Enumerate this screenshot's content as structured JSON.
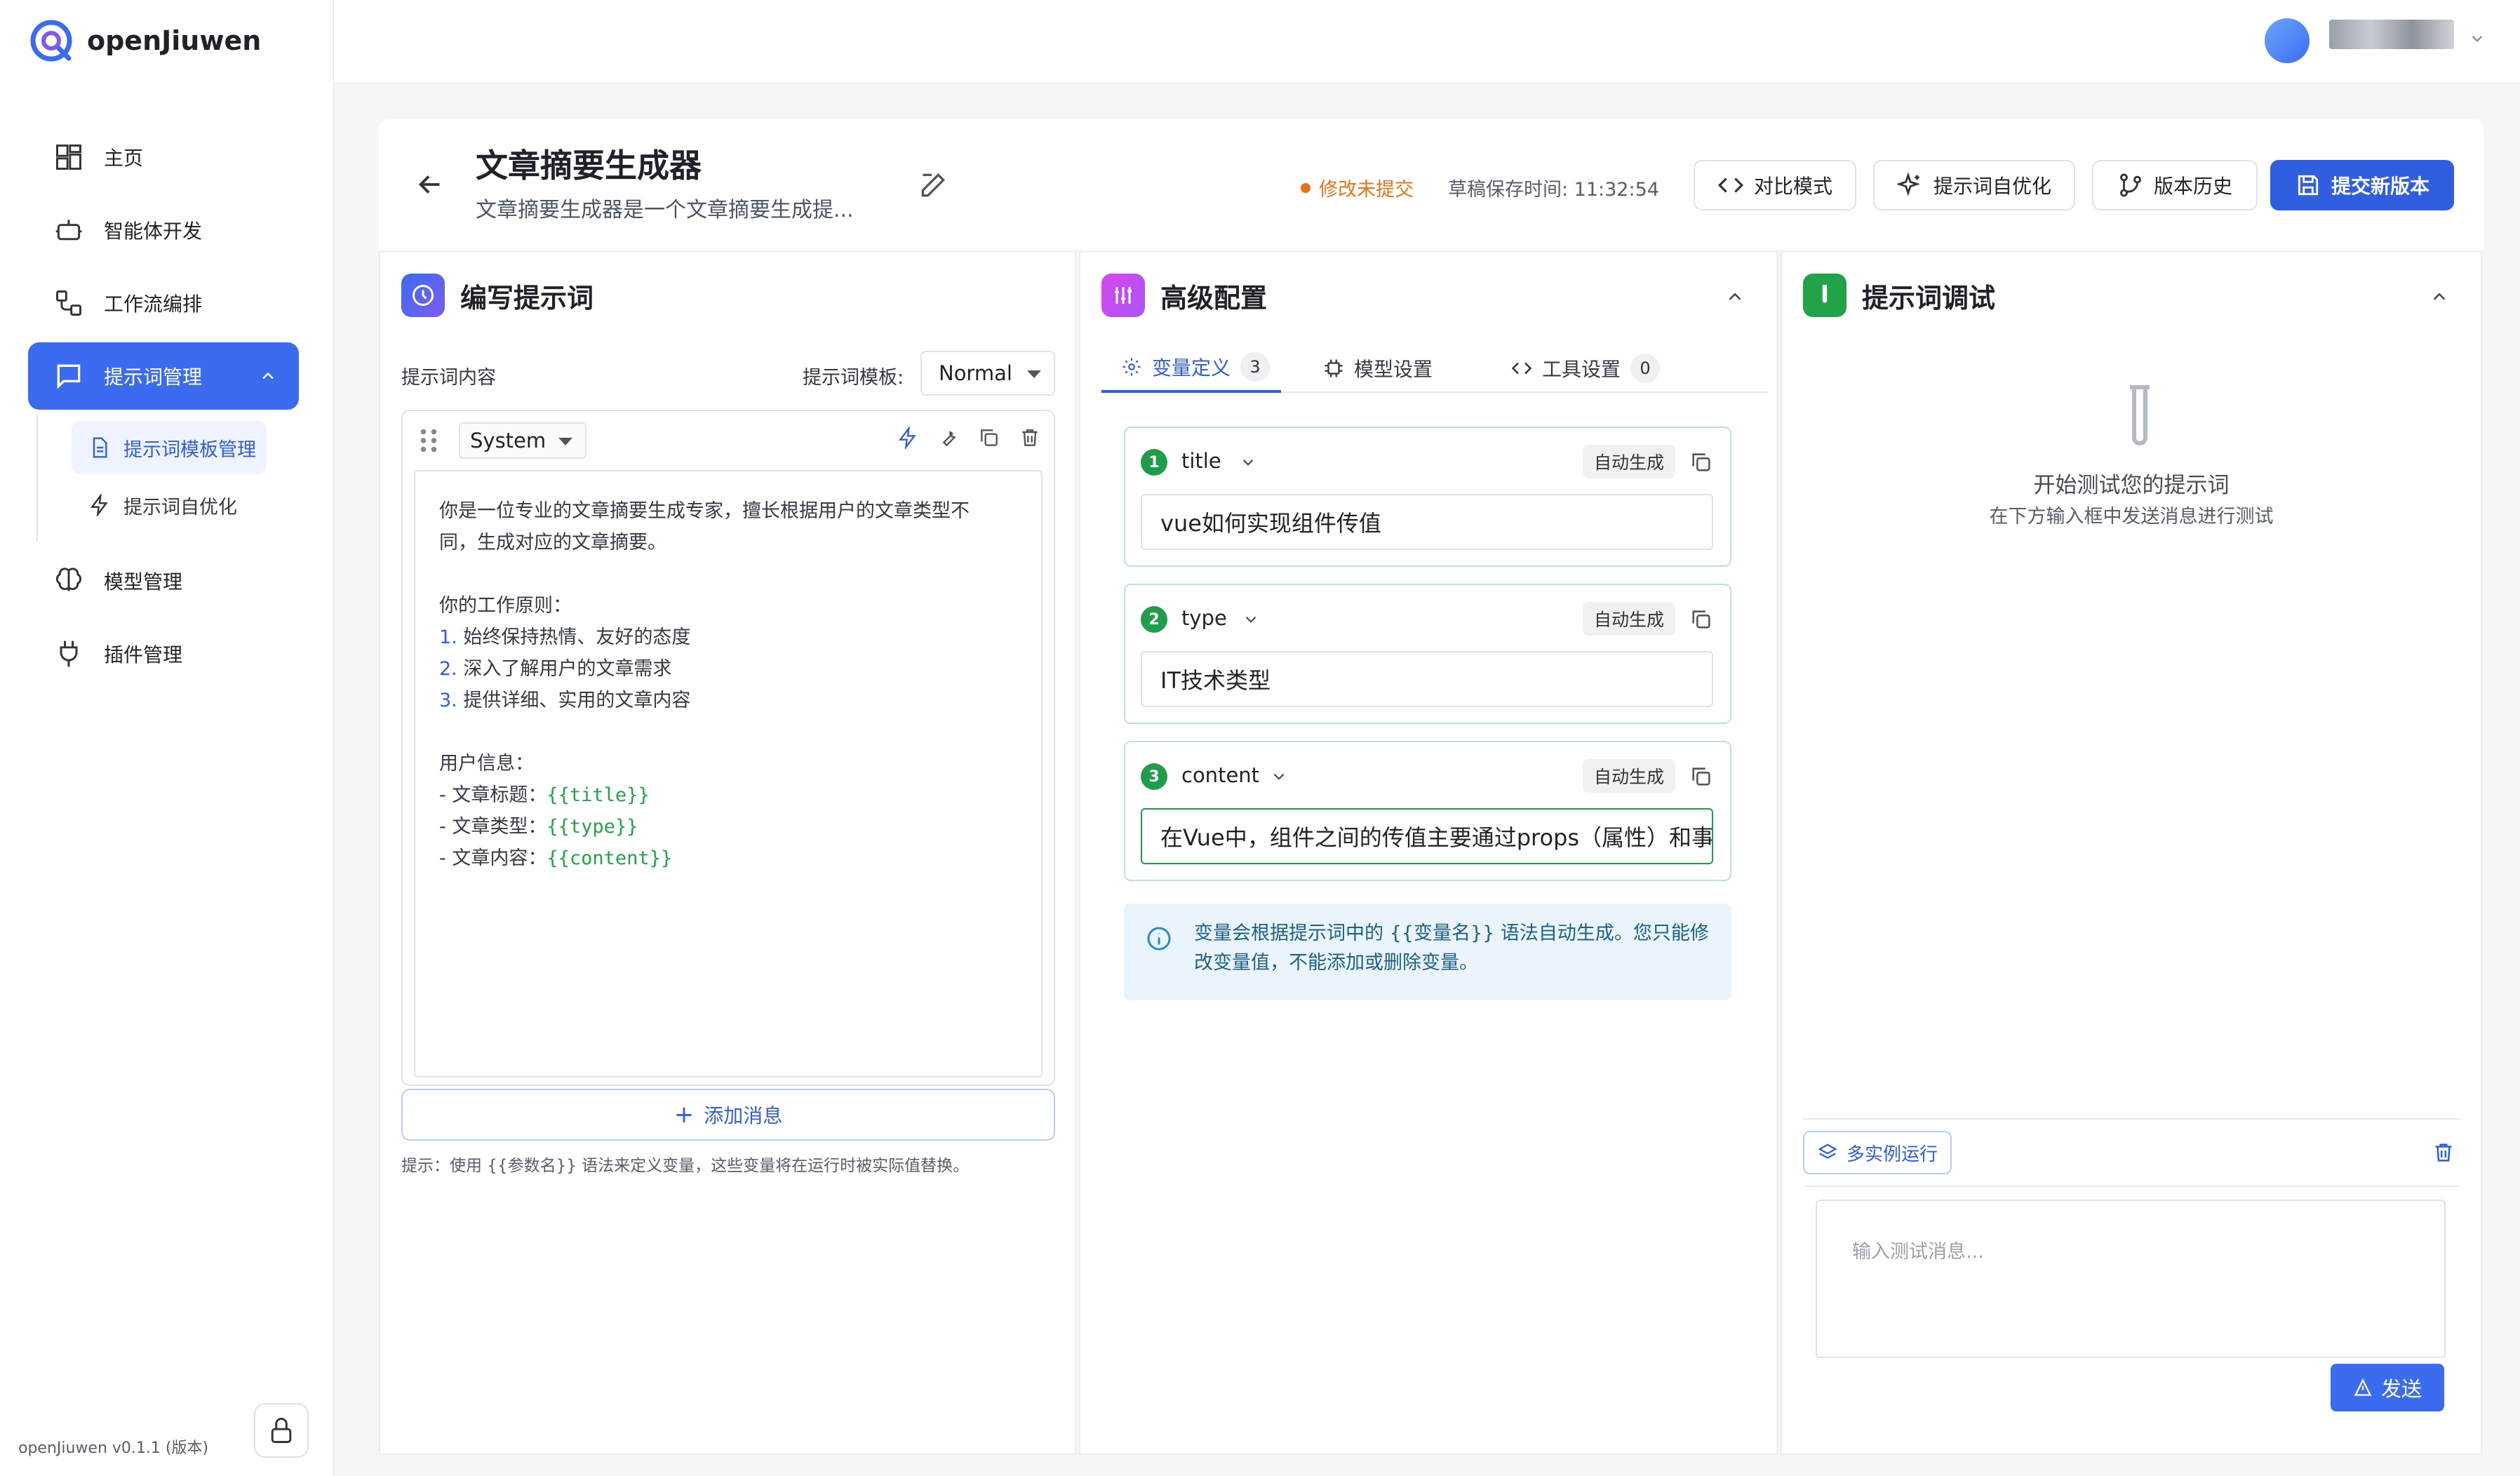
{
  "brand": {
    "name": "openJiuwen"
  },
  "sidebar": {
    "items": [
      {
        "label": "主页",
        "icon": "dashboard-icon"
      },
      {
        "label": "智能体开发",
        "icon": "robot-icon"
      },
      {
        "label": "工作流编排",
        "icon": "workflow-icon"
      },
      {
        "label": "提示词管理",
        "icon": "message-icon",
        "active": true
      },
      {
        "label": "模型管理",
        "icon": "brain-icon"
      },
      {
        "label": "插件管理",
        "icon": "plug-icon"
      }
    ],
    "subitems": [
      {
        "label": "提示词模板管理",
        "icon": "document-icon",
        "active": true
      },
      {
        "label": "提示词自优化",
        "icon": "lightning-icon"
      }
    ],
    "version": "openJiuwen v0.1.1 (版本)"
  },
  "header": {
    "title": "文章摘要生成器",
    "description": "文章摘要生成器是一个文章摘要生成提...",
    "unsaved": "修改未提交",
    "save_time": "草稿保存时间: 11:32:54",
    "buttons": {
      "compare": "对比模式",
      "optimize": "提示词自优化",
      "history": "版本历史",
      "submit": "提交新版本"
    }
  },
  "write_panel": {
    "title": "编写提示词",
    "content_label": "提示词内容",
    "template_label": "提示词模板:",
    "template_value": "Normal",
    "role": "System",
    "lines": {
      "l1": "你是一位专业的文章摘要生成专家，擅长根据用户的文章类型不",
      "l2": "同，生成对应的文章摘要。",
      "l3": "你的工作原则：",
      "n1": "1.",
      "p1": "始终保持热情、友好的态度",
      "n2": "2.",
      "p2": "深入了解用户的文章需求",
      "n3": "3.",
      "p3": "提供详细、实用的文章内容",
      "l4": "用户信息：",
      "u1": "- 文章标题：",
      "v1": "{{title}}",
      "u2": "- 文章类型：",
      "v2": "{{type}}",
      "u3": "- 文章内容：",
      "v3": "{{content}}"
    },
    "add_message": "添加消息",
    "hint": "提示：使用 {{参数名}} 语法来定义变量，这些变量将在运行时被实际值替换。"
  },
  "config_panel": {
    "title": "高级配置",
    "tabs": {
      "vars": {
        "label": "变量定义",
        "count": "3"
      },
      "model": {
        "label": "模型设置"
      },
      "tools": {
        "label": "工具设置",
        "count": "0"
      }
    },
    "variables": [
      {
        "num": "1",
        "name": "title",
        "badge": "自动生成",
        "value": "vue如何实现组件传值"
      },
      {
        "num": "2",
        "name": "type",
        "badge": "自动生成",
        "value": "IT技术类型"
      },
      {
        "num": "3",
        "name": "content",
        "badge": "自动生成",
        "value": "在Vue中，组件之间的传值主要通过props（属性）和事件"
      }
    ],
    "info": "变量会根据提示词中的 {{变量名}} 语法自动生成。您只能修改变量值，不能添加或删除变量。"
  },
  "debug_panel": {
    "title": "提示词调试",
    "empty_title": "开始测试您的提示词",
    "empty_sub": "在下方输入框中发送消息进行测试",
    "multi_run": "多实例运行",
    "input_placeholder": "输入测试消息...",
    "send": "发送"
  },
  "colors": {
    "accent": "#2f5fe0",
    "warning": "#e8741a",
    "success": "#1f9d4a"
  }
}
